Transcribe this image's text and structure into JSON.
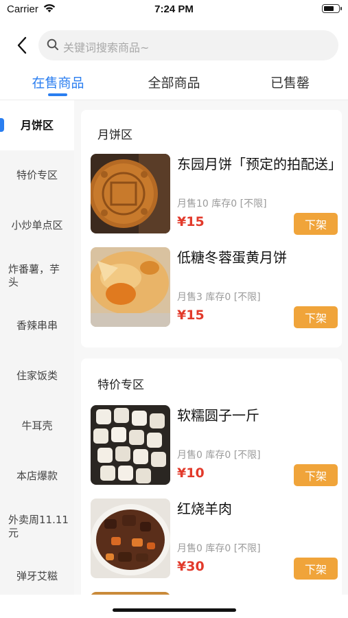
{
  "status_bar": {
    "carrier": "Carrier",
    "time": "7:24 PM",
    "battery_level": 0.75
  },
  "search": {
    "placeholder": "关键词搜索商品~"
  },
  "tabs": [
    {
      "label": "在售商品",
      "active": true
    },
    {
      "label": "全部商品",
      "active": false
    },
    {
      "label": "已售罄",
      "active": false
    }
  ],
  "sidebar": {
    "items": [
      {
        "label": "月饼区",
        "active": true
      },
      {
        "label": "特价专区"
      },
      {
        "label": "小炒单点区"
      },
      {
        "label": "炸番薯，芋头"
      },
      {
        "label": "香辣串串"
      },
      {
        "label": "住家饭类"
      },
      {
        "label": "牛耳壳"
      },
      {
        "label": "本店爆款"
      },
      {
        "label": "外卖周11.11元"
      },
      {
        "label": "弹牙艾糍"
      }
    ]
  },
  "sections": [
    {
      "title": "月饼区",
      "products": [
        {
          "name": "东园月饼「预定的拍配送」",
          "meta": "月售10 库存0 [不限]",
          "price": "¥15",
          "action": "下架",
          "image": "mooncake-photo"
        },
        {
          "name": "低糖冬蓉蛋黄月饼",
          "meta": "月售3 库存0 [不限]",
          "price": "¥15",
          "action": "下架",
          "image": "egg-yolk-mooncake-photo"
        }
      ]
    },
    {
      "title": "特价专区",
      "products": [
        {
          "name": "软糯圆子一斤",
          "meta": "月售0 库存0 [不限]",
          "price": "¥10",
          "action": "下架",
          "image": "rice-balls-photo"
        },
        {
          "name": "红烧羊肉",
          "meta": "月售0 库存0 [不限]",
          "price": "¥30",
          "action": "下架",
          "image": "braised-mutton-photo"
        }
      ]
    }
  ],
  "colors": {
    "accent": "#2a7ef0",
    "price": "#e23a2b",
    "button": "#f0a43a"
  }
}
